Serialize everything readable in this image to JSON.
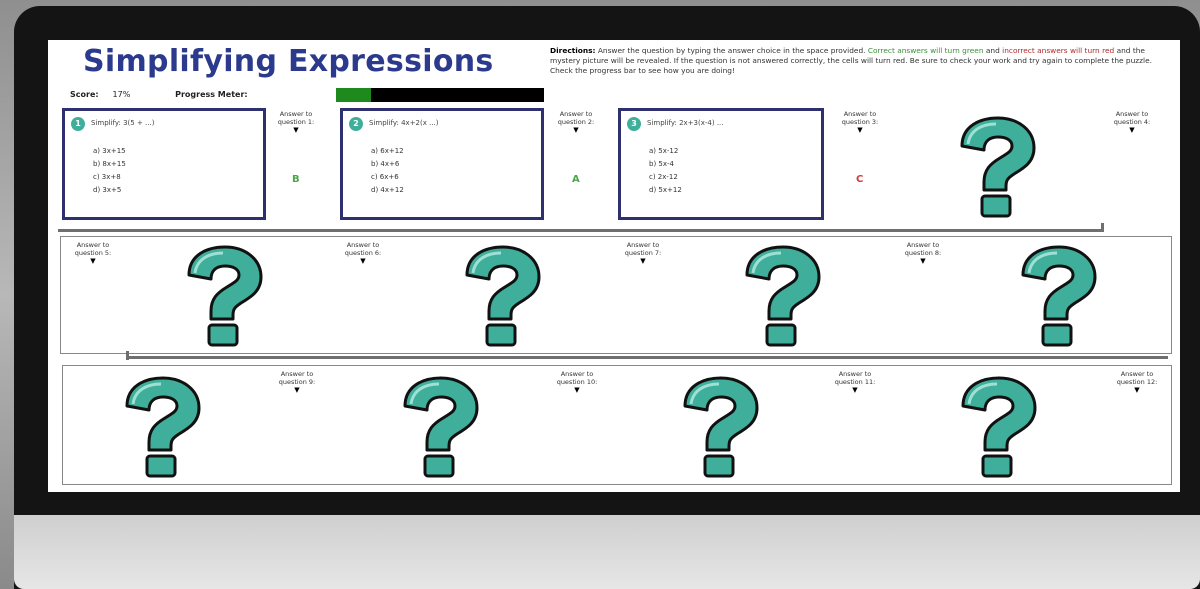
{
  "title": "Simplifying Expressions",
  "directions": {
    "label": "Directions:",
    "text1": "Answer the question by typing the answer choice in the space provided.",
    "text2_green": "Correct answers will turn green",
    "text3": "and",
    "text4_red": "incorrect answers will turn red",
    "text5": "and the mystery picture will be revealed. If the question is not answered correctly, the cells will turn red. Be sure to check your work and try again to complete the puzzle.",
    "text6": "Check the progress bar to see how you are doing!"
  },
  "status": {
    "score_label": "Score:",
    "score_value": "17%",
    "progress_label": "Progress Meter:"
  },
  "progress_fraction": 0.17,
  "questions": [
    {
      "num": "1",
      "prompt": "Simplify: 3(5 + ...)",
      "choices": [
        "a) 3x+15",
        "b) 8x+15",
        "c) 3x+8",
        "d) 3x+5"
      ],
      "answer_label": "Answer to question 1:",
      "answer_value": "B",
      "status": "correct"
    },
    {
      "num": "2",
      "prompt": "Simplify: 4x+2(x ...)",
      "choices": [
        "a) 6x+12",
        "b) 4x+6",
        "c) 6x+6",
        "d) 4x+12"
      ],
      "answer_label": "Answer to question 2:",
      "answer_value": "A",
      "status": "correct"
    },
    {
      "num": "3",
      "prompt": "Simplify: 2x+3(x-4) ...",
      "choices": [
        "a) 5x-12",
        "b) 5x-4",
        "c) 2x-12",
        "d) 5x+12"
      ],
      "answer_label": "Answer to question 3:",
      "answer_value": "C",
      "status": "incorrect"
    }
  ],
  "hidden": [
    {
      "answer_label": "Answer to question 4:"
    },
    {
      "answer_label": "Answer to question 5:"
    },
    {
      "answer_label": "Answer to question 6:"
    },
    {
      "answer_label": "Answer to question 7:"
    },
    {
      "answer_label": "Answer to question 8:"
    },
    {
      "answer_label": "Answer to question 9:"
    },
    {
      "answer_label": "Answer to question 10:"
    },
    {
      "answer_label": "Answer to question 11:"
    },
    {
      "answer_label": "Answer to question 12:"
    }
  ],
  "icons": {
    "question_mark": "teal-question-mark-icon"
  },
  "colors": {
    "title": "#2b3a8c",
    "teal": "#3fae9a",
    "progress": "#1e8a1e",
    "box_border": "#2d2f6e"
  }
}
